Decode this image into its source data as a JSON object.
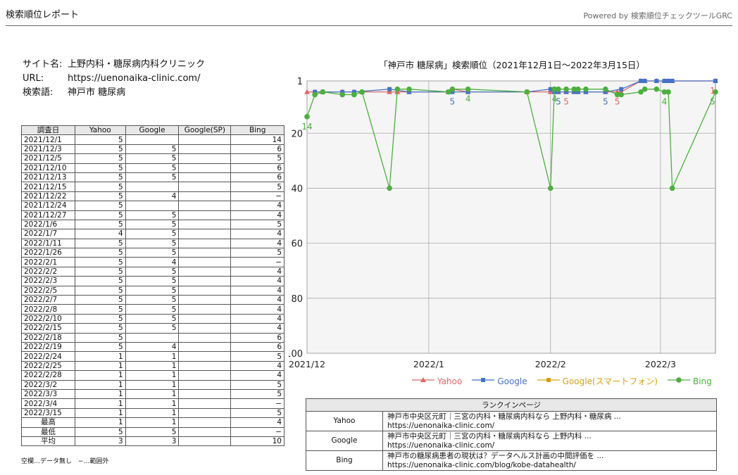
{
  "header": {
    "title": "検索順位レポート",
    "powered": "Powered by 検索順位チェックツールGRC"
  },
  "info": {
    "site_label": "サイト名:",
    "site_value": "上野内科・糖尿病内科クリニック",
    "url_label": "URL:",
    "url_value": "https://uenonaika-clinic.com/",
    "keyword_label": "検索語:",
    "keyword_value": "神戸市 糖尿病"
  },
  "table": {
    "headers": [
      "調査日",
      "Yahoo",
      "Google",
      "Google(SP)",
      "Bing"
    ],
    "rows": [
      [
        "2021/12/1",
        "5",
        "",
        "",
        "14"
      ],
      [
        "2021/12/3",
        "5",
        "5",
        "",
        "6"
      ],
      [
        "2021/12/5",
        "5",
        "5",
        "",
        "5"
      ],
      [
        "2021/12/10",
        "5",
        "5",
        "",
        "6"
      ],
      [
        "2021/12/13",
        "5",
        "5",
        "",
        "6"
      ],
      [
        "2021/12/15",
        "5",
        "",
        "",
        "5"
      ],
      [
        "2021/12/22",
        "5",
        "4",
        "",
        "−"
      ],
      [
        "2021/12/24",
        "5",
        "",
        "",
        "4"
      ],
      [
        "2021/12/27",
        "5",
        "5",
        "",
        "4"
      ],
      [
        "2022/1/6",
        "5",
        "5",
        "",
        "5"
      ],
      [
        "2022/1/7",
        "4",
        "5",
        "",
        "4"
      ],
      [
        "2022/1/11",
        "5",
        "5",
        "",
        "4"
      ],
      [
        "2022/1/26",
        "5",
        "5",
        "",
        "5"
      ],
      [
        "2022/2/1",
        "5",
        "4",
        "",
        "−"
      ],
      [
        "2022/2/2",
        "5",
        "5",
        "",
        "4"
      ],
      [
        "2022/2/3",
        "5",
        "5",
        "",
        "4"
      ],
      [
        "2022/2/5",
        "5",
        "5",
        "",
        "4"
      ],
      [
        "2022/2/7",
        "5",
        "5",
        "",
        "4"
      ],
      [
        "2022/2/8",
        "5",
        "5",
        "",
        "4"
      ],
      [
        "2022/2/10",
        "5",
        "5",
        "",
        "4"
      ],
      [
        "2022/2/15",
        "5",
        "5",
        "",
        "4"
      ],
      [
        "2022/2/18",
        "5",
        "",
        "",
        "6"
      ],
      [
        "2022/2/19",
        "5",
        "4",
        "",
        "6"
      ],
      [
        "2022/2/24",
        "1",
        "1",
        "",
        "5"
      ],
      [
        "2022/2/25",
        "1",
        "1",
        "",
        "4"
      ],
      [
        "2022/2/28",
        "1",
        "1",
        "",
        "4"
      ],
      [
        "2022/3/2",
        "1",
        "1",
        "",
        "5"
      ],
      [
        "2022/3/3",
        "1",
        "1",
        "",
        "5"
      ],
      [
        "2022/3/4",
        "1",
        "1",
        "",
        "−"
      ],
      [
        "2022/3/15",
        "1",
        "1",
        "",
        "5"
      ]
    ],
    "stats": [
      [
        "最高",
        "1",
        "1",
        "",
        "4"
      ],
      [
        "最低",
        "5",
        "5",
        "",
        "−"
      ],
      [
        "平均",
        "3",
        "3",
        "",
        "10"
      ]
    ]
  },
  "note": "空欄…データ無し　−…範囲外",
  "chart_data": {
    "type": "line",
    "title": "「神戸市 糖尿病」検索順位（2021年12月1日～2022年3月15日）",
    "x_range": [
      "2021-12-01",
      "2022-03-15"
    ],
    "x_ticks": [
      {
        "date": "2021-12-01",
        "label": "2021/12"
      },
      {
        "date": "2022-01-01",
        "label": "2022/1"
      },
      {
        "date": "2022-02-01",
        "label": "2022/2"
      },
      {
        "date": "2022-03-01",
        "label": "2022/3"
      }
    ],
    "y_ticks": [
      1,
      20,
      40,
      60,
      80,
      100
    ],
    "ylim": [
      1,
      100
    ],
    "y_inverted": true,
    "out_of_range_value": 40,
    "grid": true,
    "legend_position": "bottom",
    "series": [
      {
        "name": "Yahoo",
        "color": "#e06666",
        "marker": "triangle",
        "points": [
          [
            "2021-12-01",
            5
          ],
          [
            "2021-12-03",
            5
          ],
          [
            "2021-12-05",
            5
          ],
          [
            "2021-12-10",
            5
          ],
          [
            "2021-12-13",
            5
          ],
          [
            "2021-12-15",
            5
          ],
          [
            "2021-12-22",
            5
          ],
          [
            "2021-12-24",
            5
          ],
          [
            "2021-12-27",
            5
          ],
          [
            "2022-01-06",
            5
          ],
          [
            "2022-01-07",
            4
          ],
          [
            "2022-01-11",
            5
          ],
          [
            "2022-01-26",
            5
          ],
          [
            "2022-02-01",
            5
          ],
          [
            "2022-02-02",
            5
          ],
          [
            "2022-02-03",
            5
          ],
          [
            "2022-02-05",
            5
          ],
          [
            "2022-02-07",
            5
          ],
          [
            "2022-02-08",
            5
          ],
          [
            "2022-02-10",
            5
          ],
          [
            "2022-02-15",
            5
          ],
          [
            "2022-02-18",
            5
          ],
          [
            "2022-02-19",
            5
          ],
          [
            "2022-02-24",
            1
          ],
          [
            "2022-02-25",
            1
          ],
          [
            "2022-02-28",
            1
          ],
          [
            "2022-03-02",
            1
          ],
          [
            "2022-03-03",
            1
          ],
          [
            "2022-03-04",
            1
          ],
          [
            "2022-03-15",
            1
          ]
        ]
      },
      {
        "name": "Google",
        "color": "#4472c4",
        "marker": "square",
        "points": [
          [
            "2021-12-03",
            5
          ],
          [
            "2021-12-05",
            5
          ],
          [
            "2021-12-10",
            5
          ],
          [
            "2021-12-13",
            5
          ],
          [
            "2021-12-22",
            4
          ],
          [
            "2021-12-27",
            5
          ],
          [
            "2022-01-06",
            5
          ],
          [
            "2022-01-07",
            5
          ],
          [
            "2022-01-11",
            5
          ],
          [
            "2022-01-26",
            5
          ],
          [
            "2022-02-01",
            4
          ],
          [
            "2022-02-02",
            5
          ],
          [
            "2022-02-03",
            5
          ],
          [
            "2022-02-05",
            5
          ],
          [
            "2022-02-07",
            5
          ],
          [
            "2022-02-08",
            5
          ],
          [
            "2022-02-10",
            5
          ],
          [
            "2022-02-15",
            5
          ],
          [
            "2022-02-19",
            4
          ],
          [
            "2022-02-24",
            1
          ],
          [
            "2022-02-25",
            1
          ],
          [
            "2022-02-28",
            1
          ],
          [
            "2022-03-02",
            1
          ],
          [
            "2022-03-03",
            1
          ],
          [
            "2022-03-04",
            1
          ],
          [
            "2022-03-15",
            1
          ]
        ]
      },
      {
        "name": "Google(スマートフォン)",
        "color": "#d4a017",
        "marker": "square",
        "points": []
      },
      {
        "name": "Bing",
        "color": "#4caf3e",
        "marker": "circle",
        "points": [
          [
            "2021-12-01",
            14
          ],
          [
            "2021-12-03",
            6
          ],
          [
            "2021-12-05",
            5
          ],
          [
            "2021-12-10",
            6
          ],
          [
            "2021-12-13",
            6
          ],
          [
            "2021-12-15",
            5
          ],
          [
            "2021-12-22",
            40
          ],
          [
            "2021-12-24",
            4
          ],
          [
            "2021-12-27",
            4
          ],
          [
            "2022-01-06",
            5
          ],
          [
            "2022-01-07",
            4
          ],
          [
            "2022-01-11",
            4
          ],
          [
            "2022-01-26",
            5
          ],
          [
            "2022-02-01",
            40
          ],
          [
            "2022-02-02",
            4
          ],
          [
            "2022-02-03",
            4
          ],
          [
            "2022-02-05",
            4
          ],
          [
            "2022-02-07",
            4
          ],
          [
            "2022-02-08",
            4
          ],
          [
            "2022-02-10",
            4
          ],
          [
            "2022-02-15",
            4
          ],
          [
            "2022-02-18",
            6
          ],
          [
            "2022-02-19",
            6
          ],
          [
            "2022-02-24",
            5
          ],
          [
            "2022-02-25",
            4
          ],
          [
            "2022-02-28",
            4
          ],
          [
            "2022-03-02",
            5
          ],
          [
            "2022-03-03",
            5
          ],
          [
            "2022-03-04",
            40
          ],
          [
            "2022-03-15",
            5
          ]
        ]
      }
    ],
    "annotations": [
      {
        "series": "Bing",
        "date": "2021-12-01",
        "text": "14"
      },
      {
        "series": "Google",
        "date": "2022-01-07",
        "text": "5"
      },
      {
        "series": "Bing",
        "date": "2022-01-11",
        "text": "4"
      },
      {
        "series": "Bing",
        "date": "2022-02-02",
        "text": "4"
      },
      {
        "series": "Google",
        "date": "2022-02-03",
        "text": "5"
      },
      {
        "series": "Yahoo",
        "date": "2022-02-05",
        "text": "5"
      },
      {
        "series": "Google",
        "date": "2022-02-15",
        "text": "5"
      },
      {
        "series": "Yahoo",
        "date": "2022-02-18",
        "text": "5"
      },
      {
        "series": "Bing",
        "date": "2022-03-02",
        "text": "4"
      },
      {
        "series": "Yahoo",
        "date": "2022-03-15",
        "text": "1"
      },
      {
        "series": "Bing",
        "date": "2022-03-15",
        "text": "5"
      }
    ]
  },
  "landing": {
    "title": "ランクインページ",
    "rows": [
      {
        "engine": "Yahoo",
        "text": "神戸市中央区元町｜三宮の内科・糖尿病内科なら 上野内科・糖尿病 ...",
        "url": "https://uenonaika-clinic.com/"
      },
      {
        "engine": "Google",
        "text": "神戸市中央区元町｜三宮の内科・糖尿病内科なら 上野内科 ...",
        "url": "https://uenonaika-clinic.com/"
      },
      {
        "engine": "Bing",
        "text": "神戸市の糖尿病患者の現状は？データヘルス計画の中間評価を ...",
        "url": "https://uenonaika-clinic.com/blog/kobe-datahealth/"
      }
    ]
  }
}
